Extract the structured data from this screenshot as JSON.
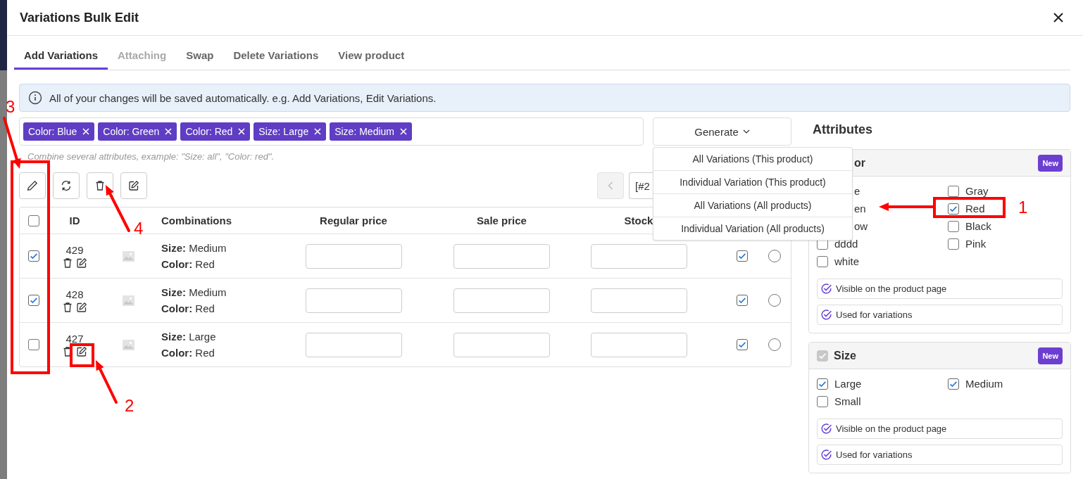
{
  "window": {
    "title": "Variations Bulk Edit"
  },
  "tabs": [
    {
      "label": "Add Variations",
      "selected": true,
      "disabled": false
    },
    {
      "label": "Attaching",
      "selected": false,
      "disabled": true
    },
    {
      "label": "Swap",
      "selected": false,
      "disabled": false
    },
    {
      "label": "Delete Variations",
      "selected": false,
      "disabled": false
    },
    {
      "label": "View product",
      "selected": false,
      "disabled": false
    }
  ],
  "notice": "All of your changes will be saved automatically. e.g. Add Variations, Edit Variations.",
  "tags": [
    {
      "label": "Color: Blue"
    },
    {
      "label": "Color: Green"
    },
    {
      "label": "Color: Red"
    },
    {
      "label": "Size: Large"
    },
    {
      "label": "Size: Medium"
    }
  ],
  "tag_hint": "Combine several attributes, example: \"Size: all\", \"Color: red\".",
  "generate": {
    "label": "Generate",
    "expanded": true,
    "menu": [
      "All Variations (This product)",
      "Individual Variation (This product)",
      "All Variations (All products)",
      "Individual Variation (All products)"
    ]
  },
  "pagination": {
    "prev_disabled": true,
    "value": "[#2"
  },
  "table": {
    "header_checked": false,
    "columns": {
      "id": "ID",
      "combinations": "Combinations",
      "regular_price": "Regular price",
      "sale_price": "Sale price",
      "stock": "Stock"
    },
    "rows": [
      {
        "selected": true,
        "id": "429",
        "combination": [
          "**Size:** Medium",
          "**Color:** Red"
        ],
        "enabled": true,
        "default": false
      },
      {
        "selected": true,
        "id": "428",
        "combination": [
          "**Size:** Medium",
          "**Color:** Red"
        ],
        "enabled": true,
        "default": false
      },
      {
        "selected": false,
        "id": "427",
        "combination": [
          "**Size:** Large",
          "**Color:** Red"
        ],
        "enabled": true,
        "default": false
      }
    ]
  },
  "attributes": {
    "title": "Attributes",
    "groups": [
      {
        "kind": "covered",
        "name": "or",
        "badge": "New",
        "options": [
          {
            "kind": "covered",
            "label": "e"
          },
          {
            "kind": "normal",
            "label": "Gray",
            "checked": false
          },
          {
            "kind": "covered",
            "label": "en"
          },
          {
            "kind": "normal",
            "label": "Red",
            "checked": true
          },
          {
            "kind": "covered",
            "label": "ow"
          },
          {
            "kind": "normal",
            "label": "Black",
            "checked": false
          },
          {
            "kind": "normal",
            "label": "dddd",
            "checked": false
          },
          {
            "kind": "normal",
            "label": "Pink",
            "checked": false
          },
          {
            "kind": "normal",
            "label": "white",
            "checked": false
          }
        ],
        "flags": [
          "Visible on the product page",
          "Used for variations"
        ]
      },
      {
        "kind": "normal",
        "name": "Size",
        "checked": true,
        "disabled": true,
        "badge": "New",
        "options": [
          {
            "kind": "normal",
            "label": "Large",
            "checked": true
          },
          {
            "kind": "normal",
            "label": "Medium",
            "checked": true
          },
          {
            "kind": "normal",
            "label": "Small",
            "checked": false
          }
        ],
        "flags": [
          "Visible on the product page",
          "Used for variations"
        ]
      }
    ]
  },
  "annotations": [
    {
      "label": "1"
    },
    {
      "label": "2"
    },
    {
      "label": "3"
    },
    {
      "label": "4"
    }
  ]
}
